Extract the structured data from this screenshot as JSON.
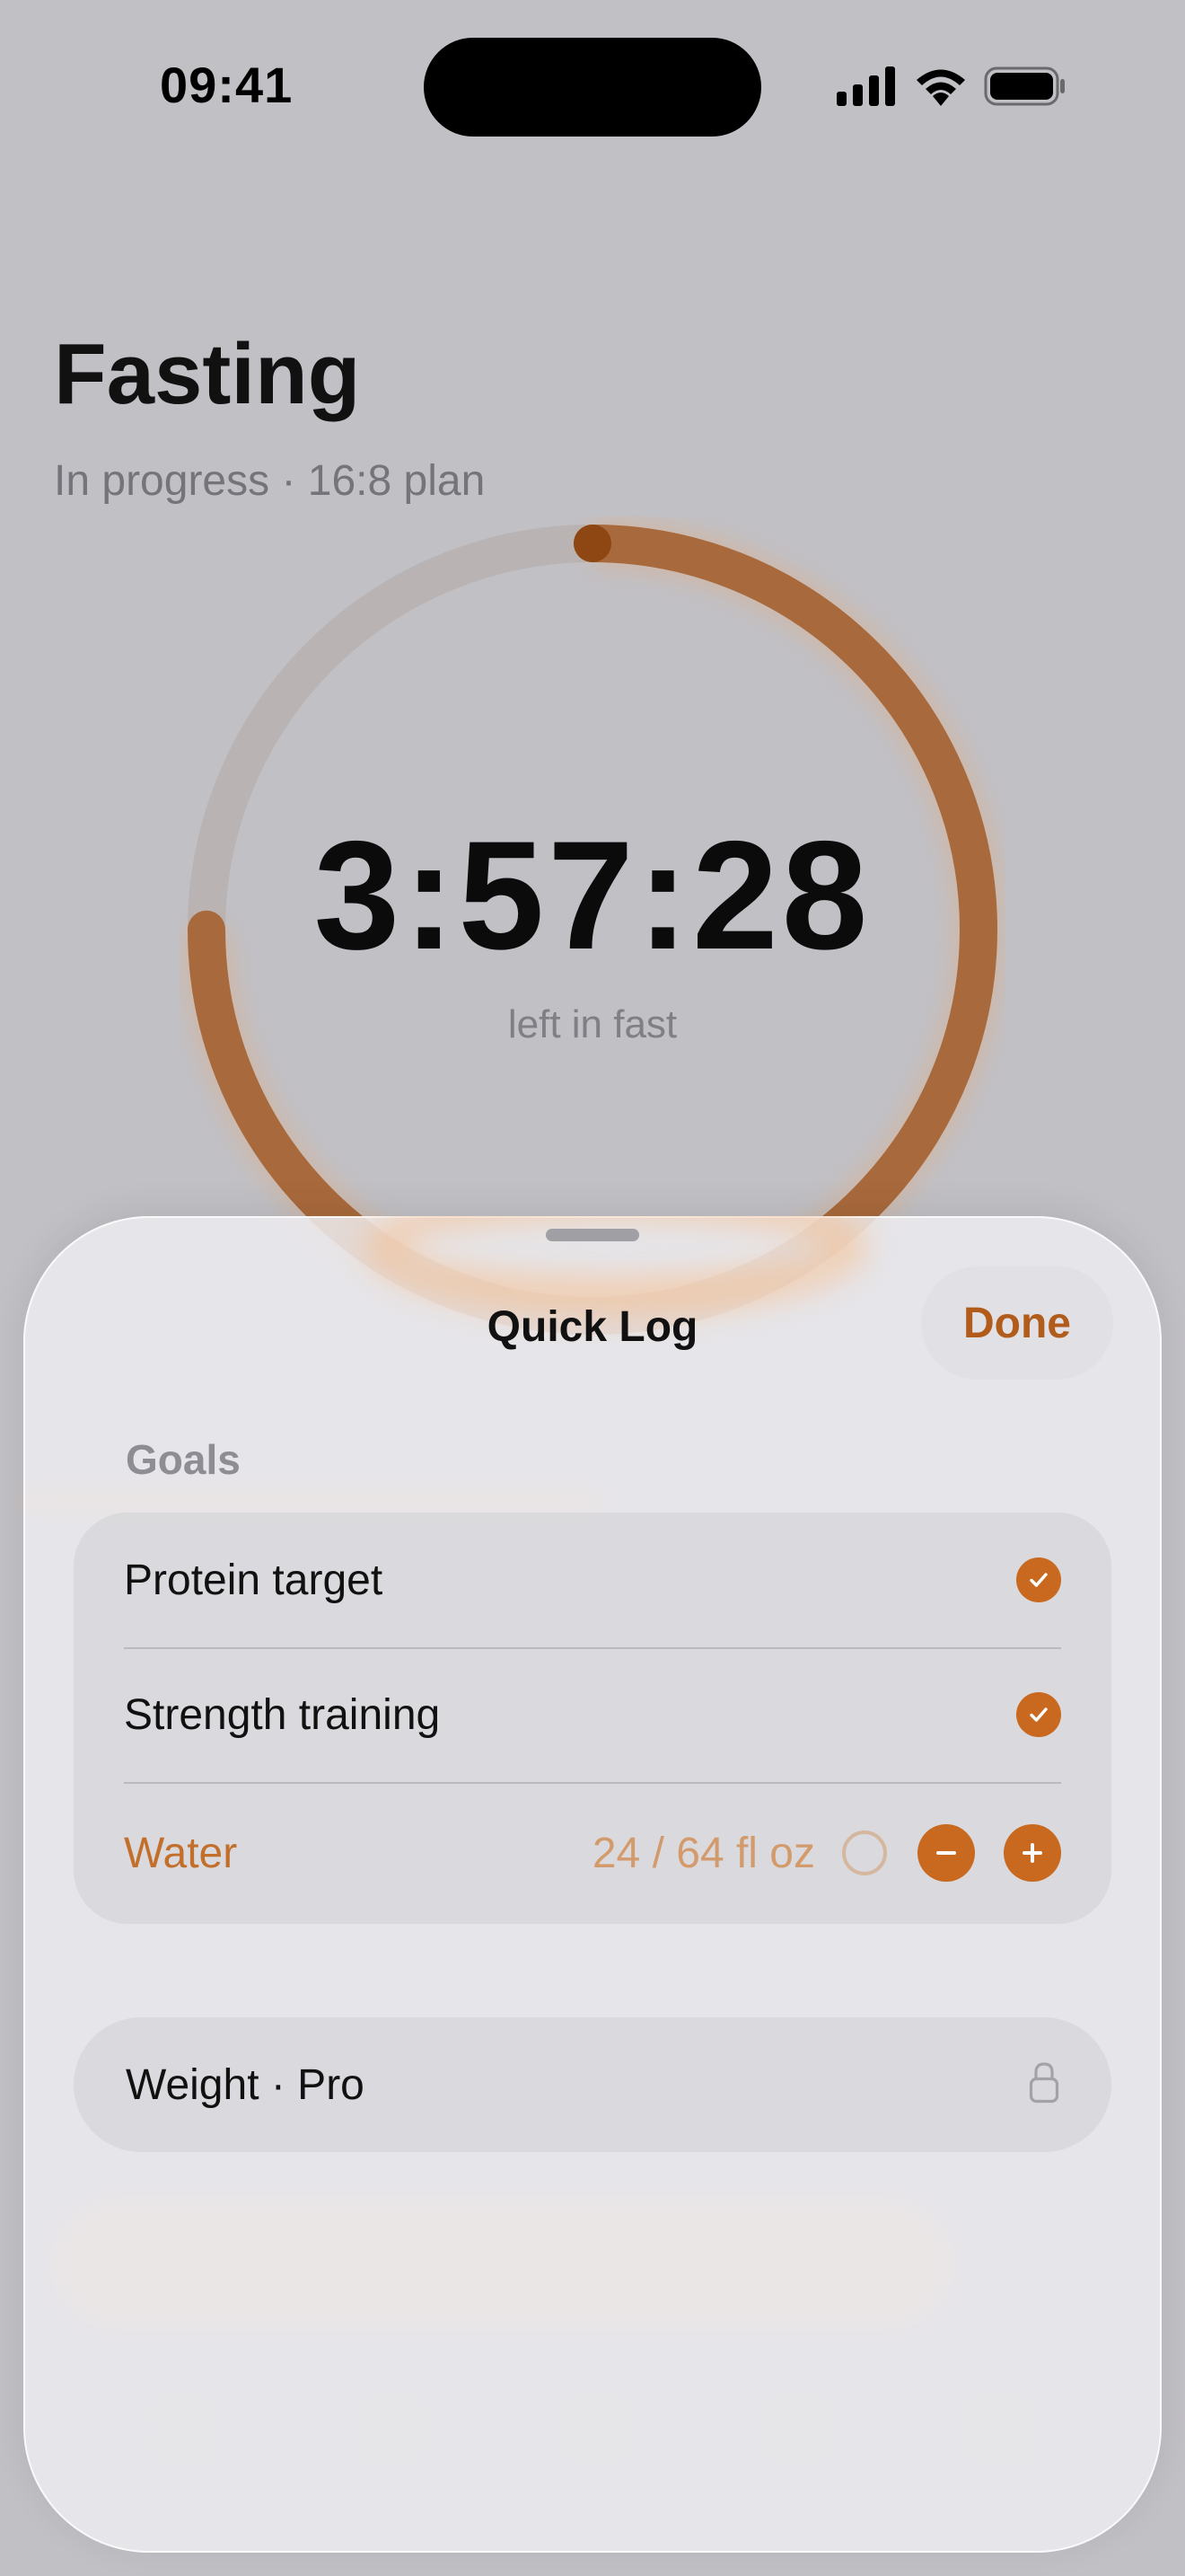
{
  "status_bar": {
    "time": "09:41",
    "icons": [
      "cellular-signal-icon",
      "wifi-icon",
      "battery-icon"
    ]
  },
  "fasting": {
    "title": "Fasting",
    "subtitle": "In progress · 16:8 plan",
    "countdown": "3:57:28",
    "countdown_label": "left in fast",
    "progress_fraction": 0.75,
    "accent_color": "#a45a26"
  },
  "sheet": {
    "title": "Quick Log",
    "done_label": "Done",
    "goals_label": "Goals",
    "goals": [
      {
        "label": "Protein target",
        "checked": true,
        "icon": "checkmark-icon"
      },
      {
        "label": "Strength training",
        "checked": true,
        "icon": "checkmark-icon"
      }
    ],
    "water": {
      "label": "Water",
      "value": "24 / 64 fl oz",
      "decrement_icon": "minus-icon",
      "increment_icon": "plus-icon"
    },
    "weight": {
      "label": "Weight · Pro",
      "icon": "lock-icon"
    }
  },
  "colors": {
    "accent": "#c8691f",
    "accent_text": "#b25c1c",
    "background": "#c1c0c5"
  }
}
